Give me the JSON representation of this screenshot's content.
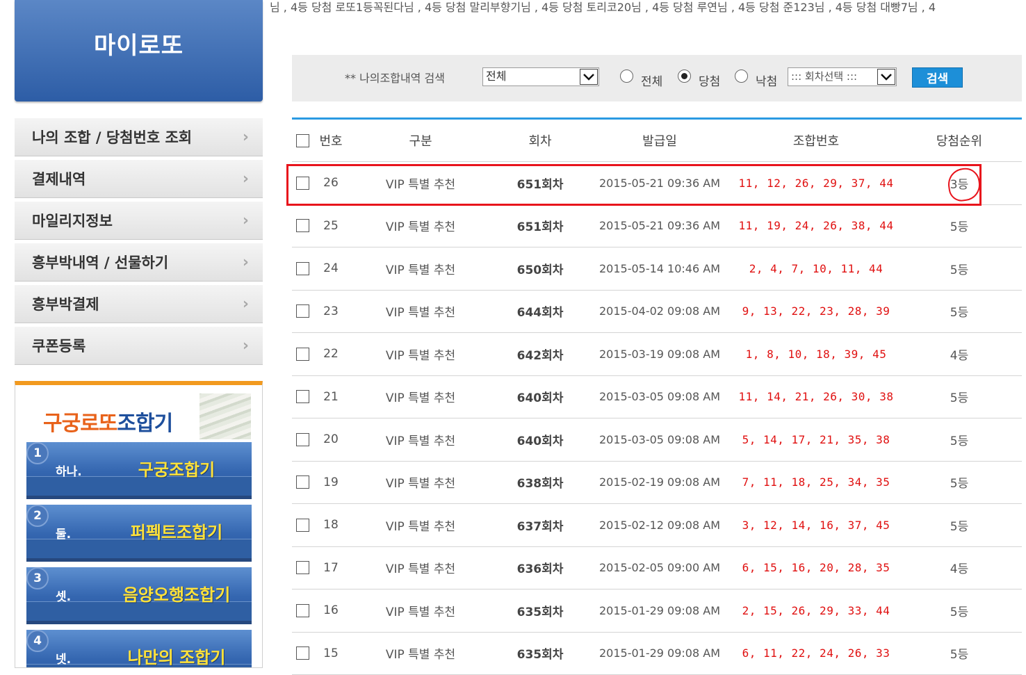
{
  "sidebar": {
    "title": "마이로또",
    "menu": [
      {
        "label": "나의 조합 / 당첨번호 조회"
      },
      {
        "label": "결제내역"
      },
      {
        "label": "마일리지정보"
      },
      {
        "label": "흥부박내역 / 선물하기"
      },
      {
        "label": "흥부박결제"
      },
      {
        "label": "쿠폰등록"
      }
    ],
    "chevron": "›",
    "combinator": {
      "title_a": "구궁로또",
      "title_b": "조합기",
      "buttons": [
        {
          "num": "1",
          "ord": "하나.",
          "name": "구궁조합기"
        },
        {
          "num": "2",
          "ord": "둘.",
          "name": "퍼펙트조합기"
        },
        {
          "num": "3",
          "ord": "셋.",
          "name": "음양오행조합기"
        },
        {
          "num": "4",
          "ord": "넷.",
          "name": "나만의 조합기"
        }
      ]
    }
  },
  "ticker": "님 , 4등 당첨 로또1등꼭된다님 , 4등 당첨 말리부향기님 , 4등 당첨 토리코20님 , 4등 당첨 루연님 , 4등 당첨 준123님 , 4등 당첨 대빵7님 , 4",
  "search": {
    "label": "** 나의조합내역 검색",
    "type_select": "전체",
    "radios": [
      {
        "label": "전체",
        "checked": false
      },
      {
        "label": "당첨",
        "checked": true
      },
      {
        "label": "낙첨",
        "checked": false
      }
    ],
    "round_select": "::: 회차선택 :::",
    "button": "검색"
  },
  "table": {
    "headers": {
      "no": "번호",
      "type": "구분",
      "round": "회차",
      "date": "발급일",
      "nums": "조합번호",
      "rank": "당첨순위"
    },
    "rows": [
      {
        "no": "26",
        "type": "VIP 특별 추천",
        "round": "651회차",
        "date": "2015-05-21 09:36 AM",
        "nums": "11, 12, 26, 29, 37, 44",
        "rank": "3등"
      },
      {
        "no": "25",
        "type": "VIP 특별 추천",
        "round": "651회차",
        "date": "2015-05-21 09:36 AM",
        "nums": "11, 19, 24, 26, 38, 44",
        "rank": "5등"
      },
      {
        "no": "24",
        "type": "VIP 특별 추천",
        "round": "650회차",
        "date": "2015-05-14 10:46 AM",
        "nums": "2, 4, 7, 10, 11, 44",
        "rank": "5등"
      },
      {
        "no": "23",
        "type": "VIP 특별 추천",
        "round": "644회차",
        "date": "2015-04-02 09:08 AM",
        "nums": "9, 13, 22, 23, 28, 39",
        "rank": "5등"
      },
      {
        "no": "22",
        "type": "VIP 특별 추천",
        "round": "642회차",
        "date": "2015-03-19 09:08 AM",
        "nums": "1, 8, 10, 18, 39, 45",
        "rank": "4등"
      },
      {
        "no": "21",
        "type": "VIP 특별 추천",
        "round": "640회차",
        "date": "2015-03-05 09:08 AM",
        "nums": "11, 14, 21, 26, 30, 38",
        "rank": "5등"
      },
      {
        "no": "20",
        "type": "VIP 특별 추천",
        "round": "640회차",
        "date": "2015-03-05 09:08 AM",
        "nums": "5, 14, 17, 21, 35, 38",
        "rank": "5등"
      },
      {
        "no": "19",
        "type": "VIP 특별 추천",
        "round": "638회차",
        "date": "2015-02-19 09:08 AM",
        "nums": "7, 11, 18, 25, 34, 35",
        "rank": "5등"
      },
      {
        "no": "18",
        "type": "VIP 특별 추천",
        "round": "637회차",
        "date": "2015-02-12 09:08 AM",
        "nums": "3, 12, 14, 16, 37, 45",
        "rank": "5등"
      },
      {
        "no": "17",
        "type": "VIP 특별 추천",
        "round": "636회차",
        "date": "2015-02-05 09:00 AM",
        "nums": "6, 15, 16, 20, 28, 35",
        "rank": "4등"
      },
      {
        "no": "16",
        "type": "VIP 특별 추천",
        "round": "635회차",
        "date": "2015-01-29 09:08 AM",
        "nums": "2, 15, 26, 29, 33, 44",
        "rank": "5등"
      },
      {
        "no": "15",
        "type": "VIP 특별 추천",
        "round": "635회차",
        "date": "2015-01-29 09:08 AM",
        "nums": "6, 11, 22, 24, 26, 33",
        "rank": "5등"
      }
    ]
  },
  "colors": {
    "accent_blue": "#2b9ae2",
    "number_red": "#e01010",
    "highlight_red": "#e8141c",
    "orange": "#f29a1f"
  }
}
